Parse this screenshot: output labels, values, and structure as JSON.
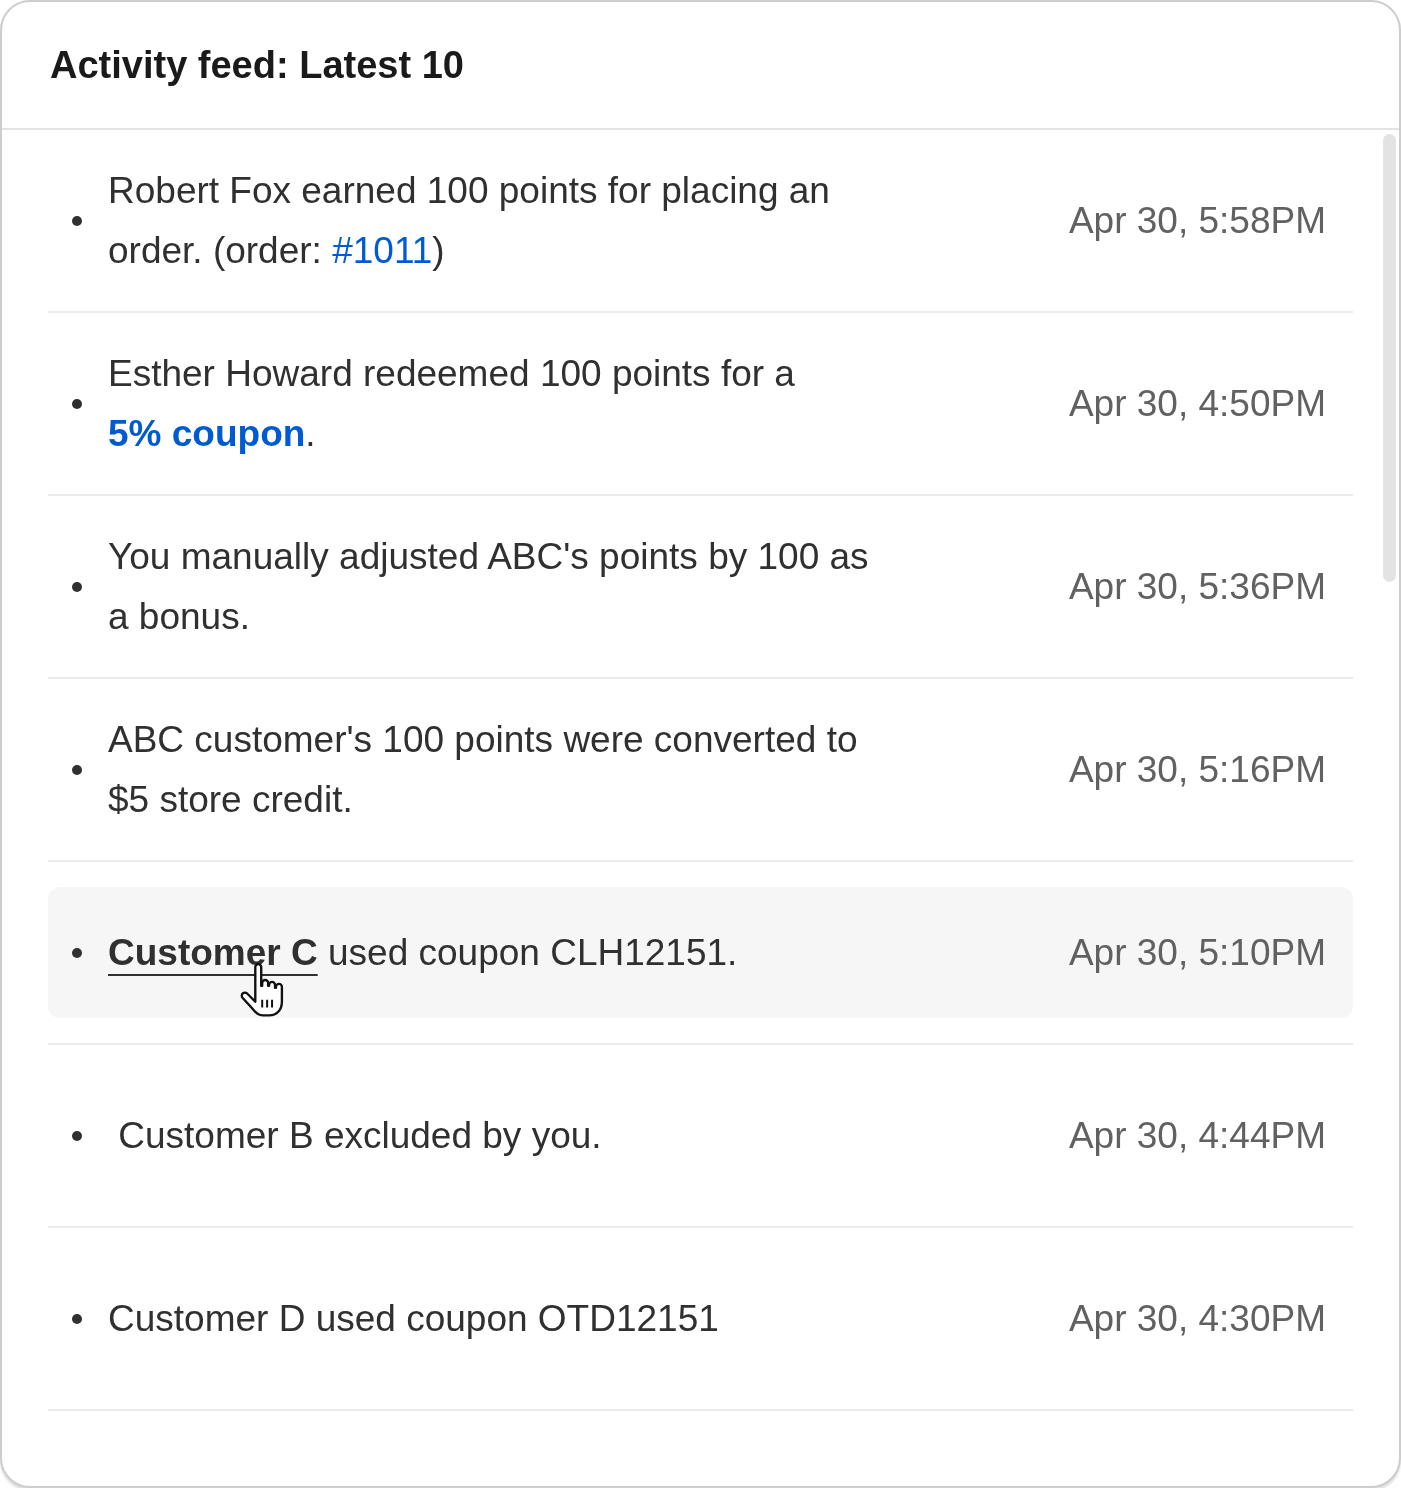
{
  "card": {
    "title": "Activity feed: Latest 10"
  },
  "items": [
    {
      "parts": [
        {
          "kind": "text",
          "text": "Robert Fox earned 100 points for placing an order. (order: "
        },
        {
          "kind": "order_link",
          "text": "#1011"
        },
        {
          "kind": "text",
          "text": ")"
        }
      ],
      "time": "Apr 30, 5:58PM",
      "hovered": false
    },
    {
      "parts": [
        {
          "kind": "text",
          "text": "Esther Howard redeemed 100 points for a "
        },
        {
          "kind": "coupon_link",
          "text": "5% coupon"
        },
        {
          "kind": "text",
          "text": "."
        }
      ],
      "time": "Apr 30, 4:50PM",
      "hovered": false
    },
    {
      "parts": [
        {
          "kind": "text",
          "text": "You manually adjusted ABC's points by 100 as a bonus."
        }
      ],
      "time": "Apr 30, 5:36PM",
      "hovered": false
    },
    {
      "parts": [
        {
          "kind": "text",
          "text": "ABC customer's 100 points were converted to $5 store credit."
        }
      ],
      "time": "Apr 30, 5:16PM",
      "hovered": false
    },
    {
      "parts": [
        {
          "kind": "customer_link",
          "text": "Customer C"
        },
        {
          "kind": "text",
          "text": " used coupon CLH12151."
        }
      ],
      "time": "Apr 30, 5:10PM",
      "hovered": true
    },
    {
      "parts": [
        {
          "kind": "text",
          "text": " Customer B excluded by you."
        }
      ],
      "time": "Apr 30, 4:44PM",
      "hovered": false
    },
    {
      "parts": [
        {
          "kind": "text",
          "text": "Customer D used coupon OTD12151"
        }
      ],
      "time": "Apr 30, 4:30PM",
      "hovered": false
    }
  ]
}
